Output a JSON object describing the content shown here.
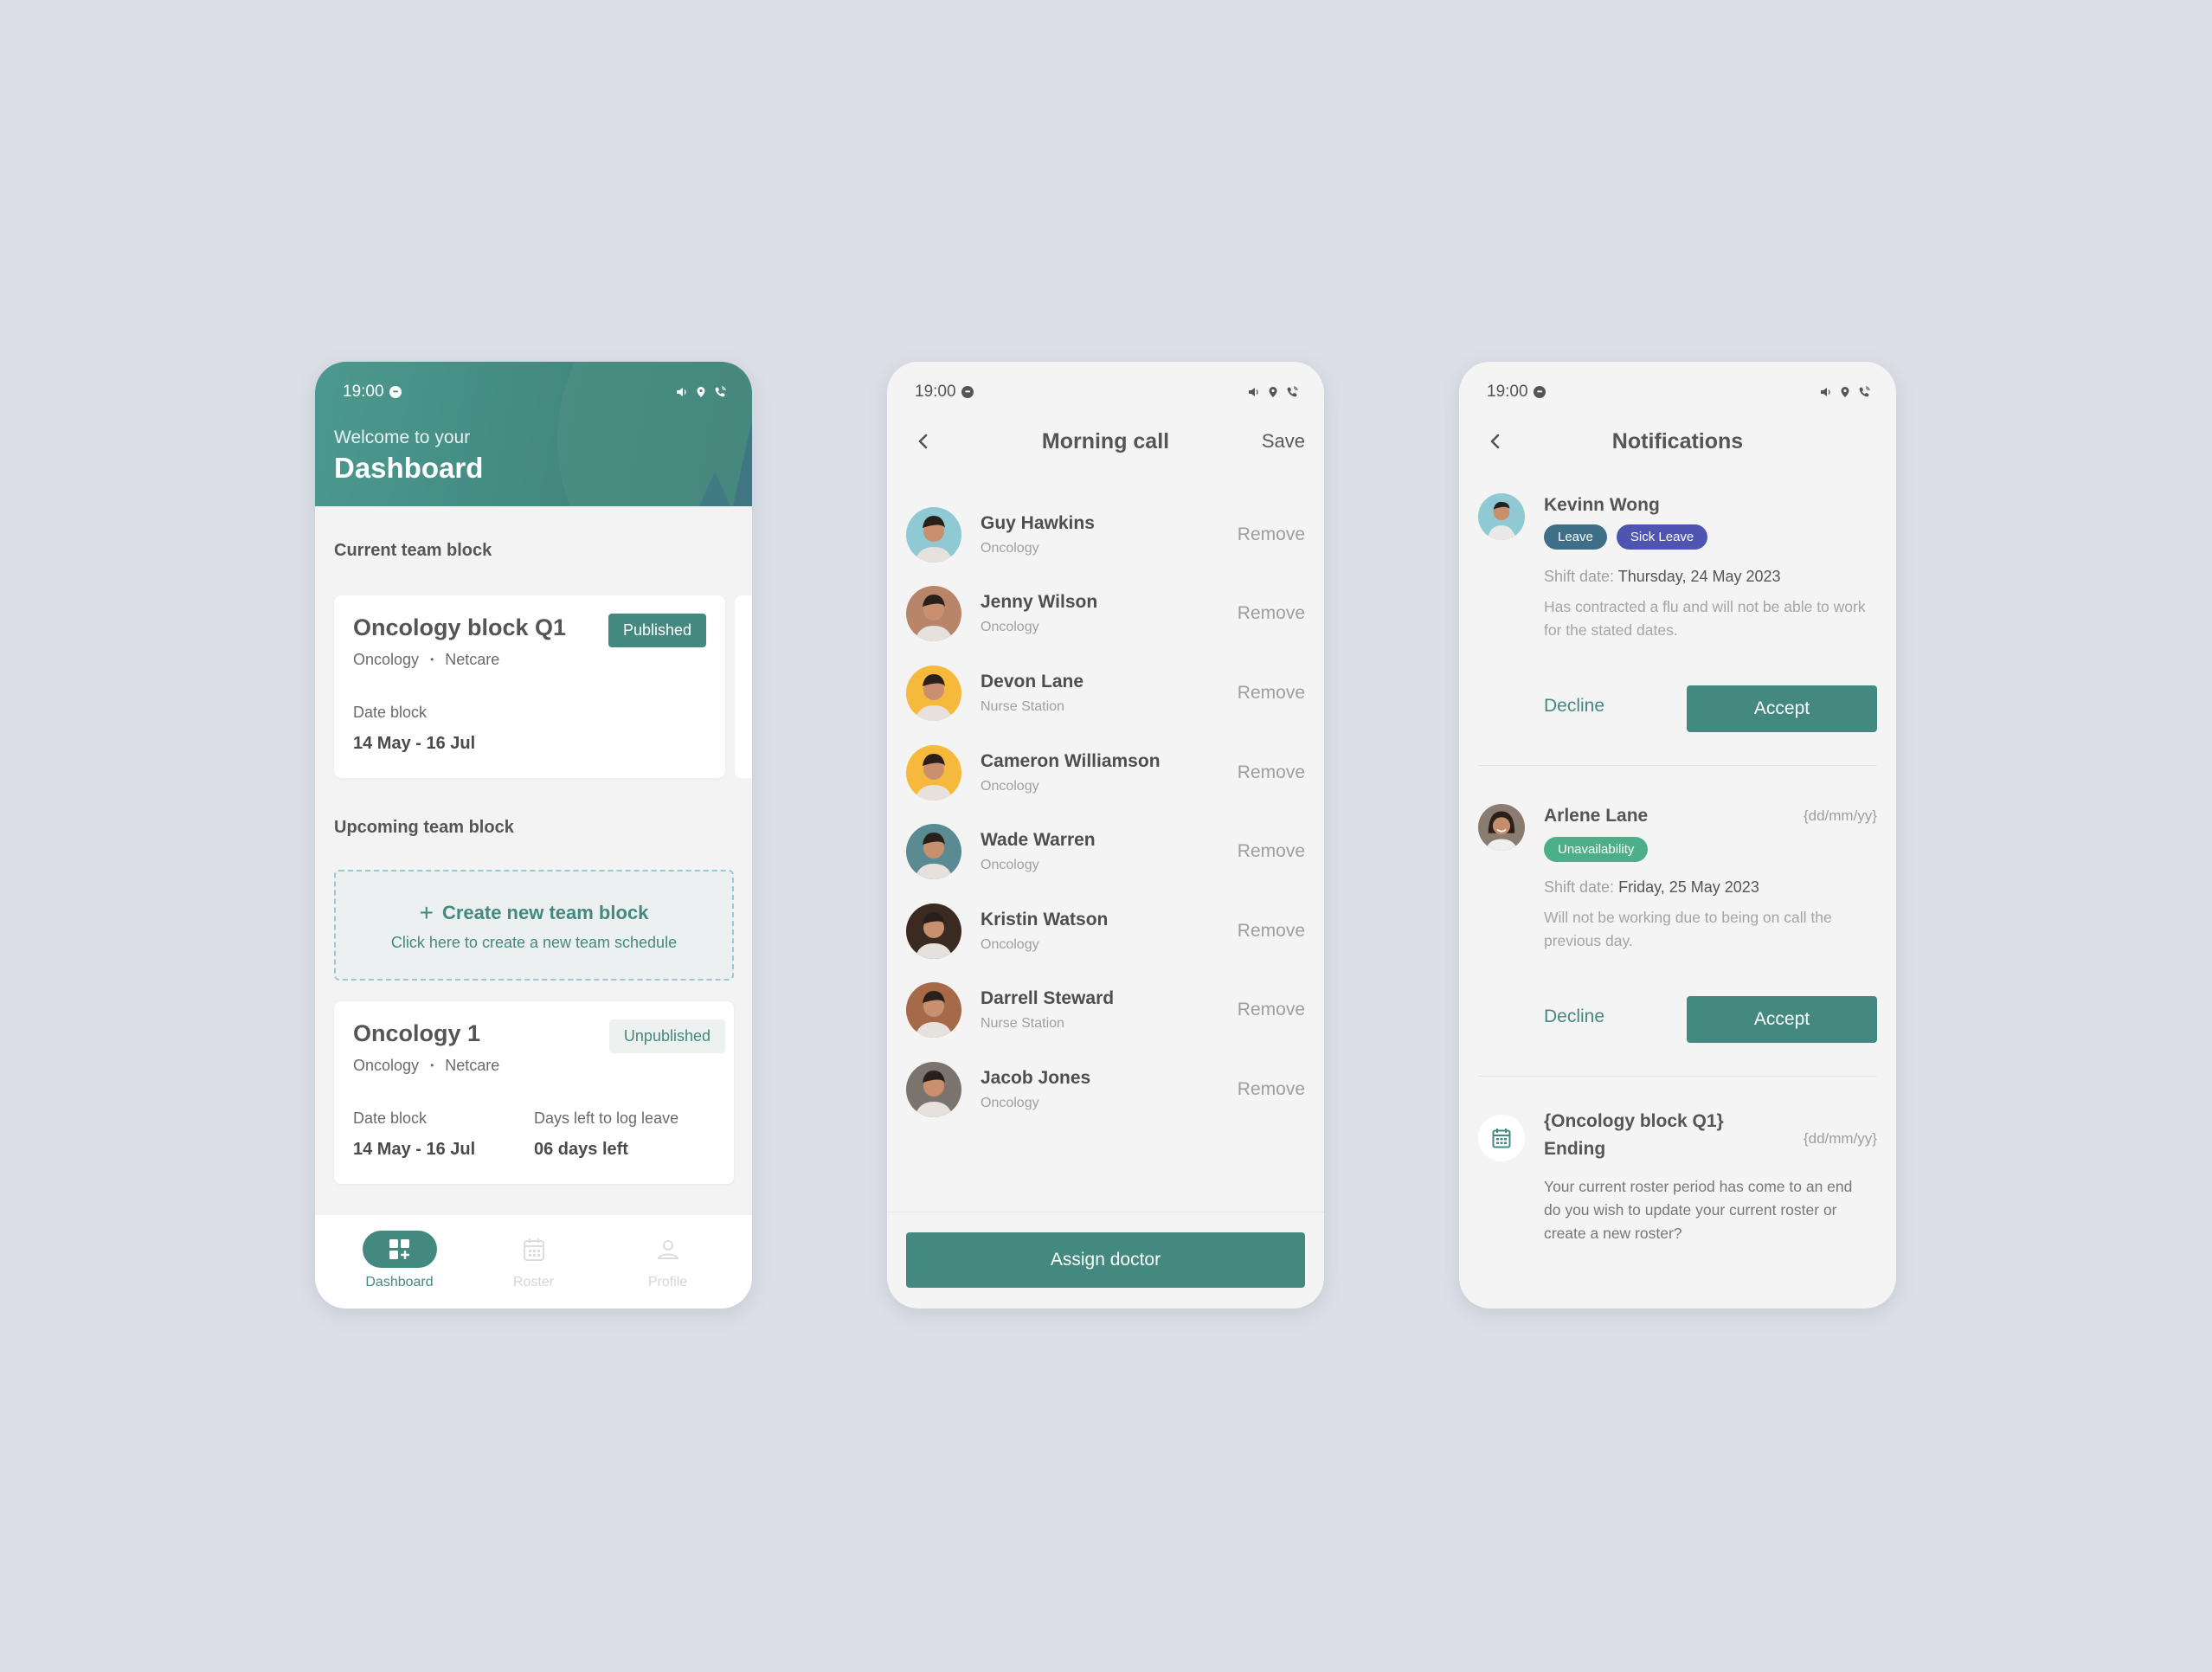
{
  "status_bar": {
    "time": "19:00"
  },
  "dashboard": {
    "welcome": "Welcome to your",
    "title": "Dashboard",
    "current_section": "Current team block",
    "current_block": {
      "name": "Oncology block Q1",
      "department": "Oncology",
      "hospital": "Netcare",
      "separator": "•",
      "status": "Published",
      "date_label": "Date block",
      "date_value": "14 May - 16 Jul"
    },
    "upcoming_section": "Upcoming team block",
    "create": {
      "plus": "+",
      "title": "Create new team block",
      "subtitle": "Click here to create a new team schedule"
    },
    "upcoming_block": {
      "name": "Oncology 1",
      "department": "Oncology",
      "hospital": "Netcare",
      "separator": "•",
      "status": "Unpublished",
      "date_label": "Date block",
      "date_value": "14 May - 16 Jul",
      "days_label": "Days left to log leave",
      "days_value": "06 days left"
    },
    "nav": [
      {
        "label": "Dashboard",
        "icon": "dashboard-icon",
        "active": true
      },
      {
        "label": "Roster",
        "icon": "calendar-icon",
        "active": false
      },
      {
        "label": "Profile",
        "icon": "profile-icon",
        "active": false
      }
    ]
  },
  "morning_call": {
    "title": "Morning call",
    "save_label": "Save",
    "remove_label": "Remove",
    "doctors": [
      {
        "name": "Guy Hawkins",
        "department": "Oncology",
        "avatar_bg": "#8ec9d4"
      },
      {
        "name": "Jenny Wilson",
        "department": "Oncology",
        "avatar_bg": "#b8856a"
      },
      {
        "name": "Devon Lane",
        "department": "Nurse Station",
        "avatar_bg": "#f6b93b"
      },
      {
        "name": "Cameron Williamson",
        "department": "Oncology",
        "avatar_bg": "#f6b93b"
      },
      {
        "name": "Wade Warren",
        "department": "Oncology",
        "avatar_bg": "#5a8b93"
      },
      {
        "name": "Kristin Watson",
        "department": "Oncology",
        "avatar_bg": "#3a2a22"
      },
      {
        "name": "Darrell Steward",
        "department": "Nurse Station",
        "avatar_bg": "#a66a4a"
      },
      {
        "name": "Jacob Jones",
        "department": "Oncology",
        "avatar_bg": "#7a746c"
      }
    ],
    "assign_label": "Assign doctor"
  },
  "notifications": {
    "title": "Notifications",
    "shift_label": "Shift date:",
    "decline_label": "Decline",
    "accept_label": "Accept",
    "items": [
      {
        "name": "Kevinn Wong",
        "date": "",
        "tags": [
          {
            "label": "Leave",
            "color": "#3f6f88"
          },
          {
            "label": "Sick Leave",
            "color": "#4e55b0"
          }
        ],
        "shift_date": "Thursday, 24 May 2023",
        "description": "Has contracted a flu and will not be able to work for the stated dates.",
        "avatar_bg": "#8ec9d4"
      },
      {
        "name": "Arlene Lane",
        "date": "{dd/mm/yy}",
        "tags": [
          {
            "label": "Unavailability",
            "color": "#4caf8a"
          }
        ],
        "shift_date": "Friday, 25 May 2023",
        "description": "Will not be working due to being on call the previous day.",
        "avatar_bg": "#6d5a4e"
      }
    ],
    "roster_notice": {
      "title_line1": "{Oncology block Q1}",
      "title_line2": "Ending",
      "date": "{dd/mm/yy}",
      "description": "Your current roster period has come to an end do you wish to update your current roster or create a new roster?"
    }
  },
  "colors": {
    "primary": "#43897f",
    "background": "#dcdfe6",
    "screen": "#f4f4f4"
  }
}
